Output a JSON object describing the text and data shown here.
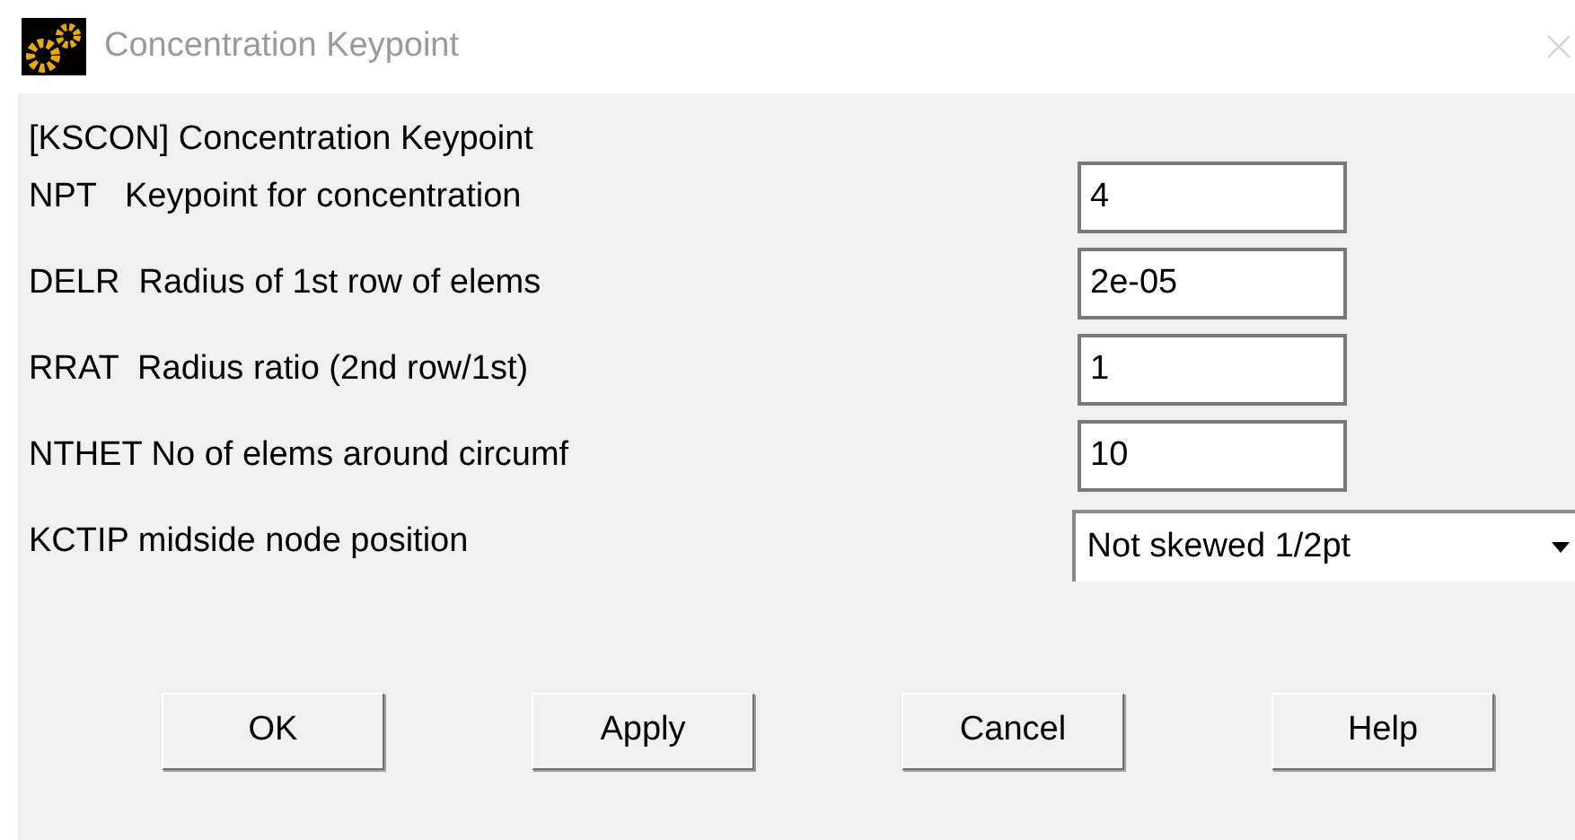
{
  "window": {
    "title": "Concentration Keypoint"
  },
  "heading": "[KSCON]  Concentration Keypoint",
  "fields": [
    {
      "kind": "text",
      "label": "NPT   Keypoint for concentration",
      "value": "4"
    },
    {
      "kind": "text",
      "label": "DELR  Radius of 1st row of elems",
      "value": "2e-05"
    },
    {
      "kind": "text",
      "label": "RRAT  Radius ratio (2nd row/1st)",
      "value": "1"
    },
    {
      "kind": "text",
      "label": "NTHET No of elems around circumf",
      "value": "10"
    },
    {
      "kind": "dropdown",
      "label": "KCTIP midside node position",
      "value": "Not skewed 1/2pt"
    }
  ],
  "buttons": [
    "OK",
    "Apply",
    "Cancel",
    "Help"
  ]
}
